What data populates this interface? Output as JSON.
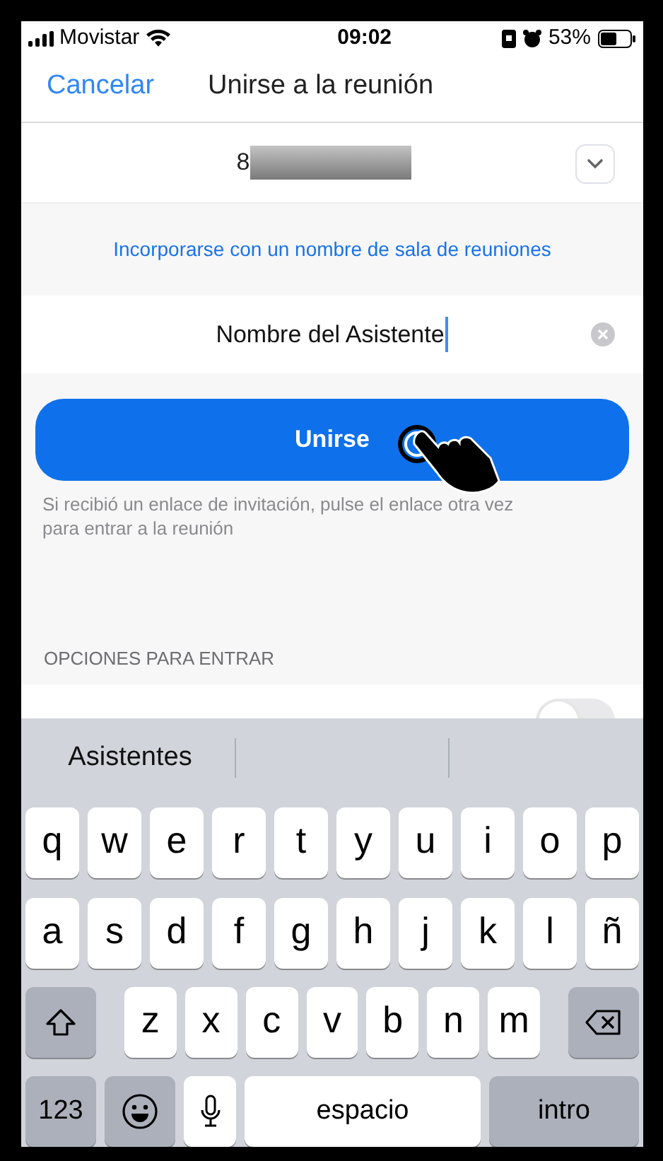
{
  "status_bar": {
    "carrier": "Movistar",
    "time": "09:02",
    "battery": "53%"
  },
  "nav": {
    "cancel": "Cancelar",
    "title": "Unirse a la reunión"
  },
  "meeting_id": {
    "value": "8"
  },
  "room_name_link": "Incorporarse con un nombre de sala de reuniones",
  "name_field": {
    "value": "Nombre del Asistente"
  },
  "join_button": "Unirse",
  "help_text": "Si recibió un enlace de invitación, pulse el enlace otra vez para entrar a la reunión",
  "options_header": "OPCIONES PARA ENTRAR",
  "options_toggle": {
    "on": false
  },
  "keyboard": {
    "suggestions": [
      "Asistentes"
    ],
    "rows": [
      [
        "q",
        "w",
        "e",
        "r",
        "t",
        "y",
        "u",
        "i",
        "o",
        "p"
      ],
      [
        "a",
        "s",
        "d",
        "f",
        "g",
        "h",
        "j",
        "k",
        "l",
        "ñ"
      ],
      [
        "z",
        "x",
        "c",
        "v",
        "b",
        "n",
        "m"
      ]
    ],
    "numbers_key": "123",
    "space_key": "espacio",
    "return_key": "intro"
  }
}
